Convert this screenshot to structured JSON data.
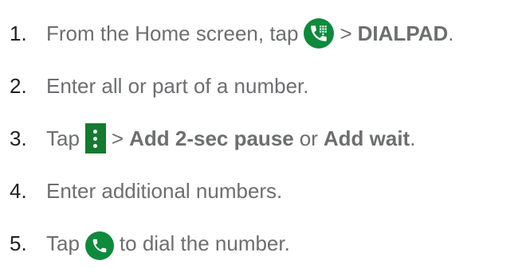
{
  "steps": [
    {
      "number": "1.",
      "text_before": "From the Home screen, tap",
      "icon": "phone-dialpad-icon",
      "separator": ">",
      "target": "DIALPAD",
      "end": "."
    },
    {
      "number": "2.",
      "text": "Enter all or part of a number."
    },
    {
      "number": "3.",
      "text_before": "Tap",
      "icon": "more-options-icon",
      "separator": ">",
      "option_1": "Add 2-sec pause",
      "conjunction": "or",
      "option_2": "Add wait",
      "end": "."
    },
    {
      "number": "4.",
      "text": "Enter additional numbers."
    },
    {
      "number": "5.",
      "text_before": "Tap",
      "icon": "call-icon",
      "text_after": "to dial the number."
    }
  ],
  "colors": {
    "icon_green": "#0e8a3c",
    "menu_green": "#157a2f",
    "text_gray": "#6d6e71",
    "number_dark": "#231f20"
  }
}
